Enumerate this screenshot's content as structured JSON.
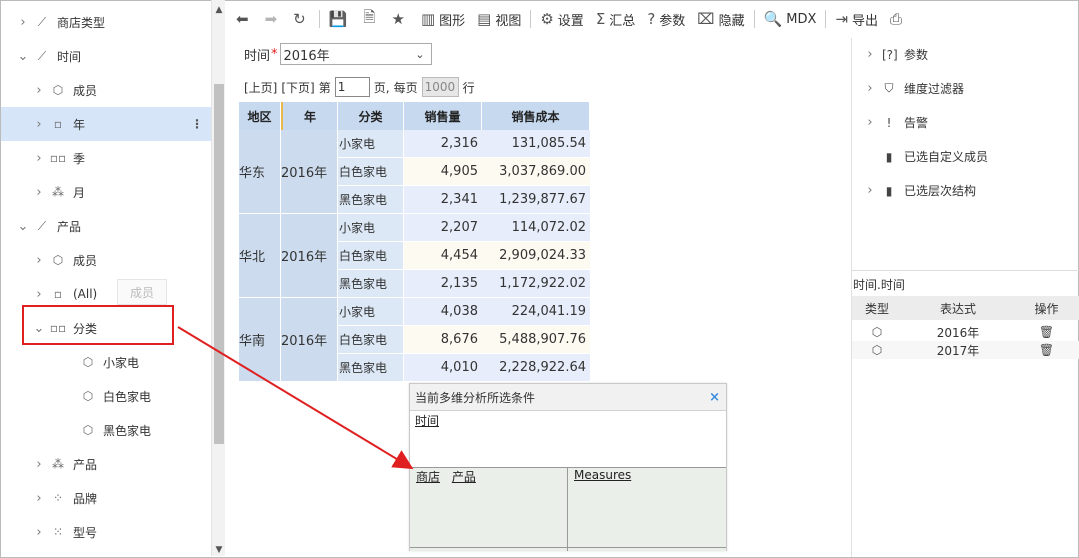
{
  "tree": {
    "items": [
      {
        "label": "商店类型",
        "icon": "hierarchy-icon",
        "glyph": "⟋",
        "chev": "›",
        "indent": 1
      },
      {
        "label": "时间",
        "icon": "hierarchy-icon",
        "glyph": "⟋",
        "chev": "⌄",
        "indent": 1
      },
      {
        "label": "成员",
        "icon": "cube-icon",
        "glyph": "⬡",
        "chev": "›",
        "indent": 2
      },
      {
        "label": "年",
        "icon": "level-icon",
        "glyph": "▫",
        "chev": "›",
        "indent": 2,
        "selected": true
      },
      {
        "label": "季",
        "icon": "level-icon",
        "glyph": "▫▫",
        "chev": "›",
        "indent": 2
      },
      {
        "label": "月",
        "icon": "level-icon",
        "glyph": "⁂",
        "chev": "›",
        "indent": 2
      },
      {
        "label": "产品",
        "icon": "hierarchy-icon",
        "glyph": "⟋",
        "chev": "⌄",
        "indent": 1
      },
      {
        "label": "成员",
        "icon": "cube-icon",
        "glyph": "⬡",
        "chev": "›",
        "indent": 2
      },
      {
        "label": "(All)",
        "icon": "level-icon",
        "glyph": "▫",
        "chev": "›",
        "indent": 2
      },
      {
        "label": "分类",
        "icon": "level-icon",
        "glyph": "▫▫",
        "chev": "⌄",
        "indent": 2
      },
      {
        "label": "小家电",
        "icon": "cube-icon",
        "glyph": "⬡",
        "chev": "",
        "indent": 3
      },
      {
        "label": "白色家电",
        "icon": "cube-icon",
        "glyph": "⬡",
        "chev": "",
        "indent": 3
      },
      {
        "label": "黑色家电",
        "icon": "cube-icon",
        "glyph": "⬡",
        "chev": "",
        "indent": 3
      },
      {
        "label": "产品",
        "icon": "level-icon",
        "glyph": "⁂",
        "chev": "›",
        "indent": 2
      },
      {
        "label": "品牌",
        "icon": "level-icon",
        "glyph": "⁘",
        "chev": "›",
        "indent": 2
      },
      {
        "label": "型号",
        "icon": "level-icon",
        "glyph": "⁙",
        "chev": "›",
        "indent": 2
      }
    ],
    "ghost_label": "成员",
    "more_menu": "⋮"
  },
  "toolbar": {
    "buttons": [
      {
        "name": "back-button",
        "icon": "arrow-left-icon",
        "glyph": "⬅",
        "label": "",
        "disabled": false
      },
      {
        "name": "forward-button",
        "icon": "arrow-right-icon",
        "glyph": "➡",
        "label": "",
        "disabled": true
      },
      {
        "name": "refresh-button",
        "icon": "refresh-icon",
        "glyph": "↻",
        "label": "",
        "disabled": false
      },
      {
        "sep": true
      },
      {
        "name": "save-button",
        "icon": "save-icon",
        "glyph": "💾",
        "label": "",
        "disabled": false
      },
      {
        "name": "saveas-button",
        "icon": "save-as-icon",
        "glyph": "🗎",
        "label": "",
        "disabled": false
      },
      {
        "name": "favorite-button",
        "icon": "star-icon",
        "glyph": "★",
        "label": "",
        "disabled": false
      },
      {
        "name": "chart-button",
        "icon": "bar-chart-icon",
        "glyph": "▥",
        "label": "图形"
      },
      {
        "name": "view-button",
        "icon": "view-icon",
        "glyph": "▤",
        "label": "视图"
      },
      {
        "sep": true
      },
      {
        "name": "settings-button",
        "icon": "gear-icon",
        "glyph": "⚙",
        "label": "设置"
      },
      {
        "name": "summary-button",
        "icon": "sigma-icon",
        "glyph": "Σ",
        "label": "汇总"
      },
      {
        "name": "param-button",
        "icon": "question-icon",
        "glyph": "?",
        "label": "参数"
      },
      {
        "name": "hide-button",
        "icon": "hide-icon",
        "glyph": "⌧",
        "label": "隐藏"
      },
      {
        "sep": true
      },
      {
        "name": "mdx-button",
        "icon": "search-icon",
        "glyph": "🔍",
        "label": "MDX"
      },
      {
        "sep": true
      },
      {
        "name": "export-button",
        "icon": "export-icon",
        "glyph": "⇥",
        "label": "导出"
      },
      {
        "name": "print-button",
        "icon": "print-icon",
        "glyph": "⎙",
        "label": ""
      }
    ]
  },
  "filter": {
    "label": "时间",
    "required_mark": "*",
    "value": "2016年"
  },
  "pager": {
    "prev": "[上页]",
    "next": "[下页]",
    "page_prefix": "第",
    "page_value": "1",
    "page_suffix": "页,",
    "size_prefix": "每页",
    "size_value": "1000",
    "size_suffix": "行"
  },
  "table": {
    "headers": [
      "地区",
      "年",
      "分类",
      "销售量",
      "销售成本"
    ],
    "groups": [
      {
        "region": "华东",
        "year": "2016年",
        "rows": [
          {
            "cat": "小家电",
            "qty": "2,316",
            "cost": "131,085.54"
          },
          {
            "cat": "白色家电",
            "qty": "4,905",
            "cost": "3,037,869.00"
          },
          {
            "cat": "黑色家电",
            "qty": "2,341",
            "cost": "1,239,877.67"
          }
        ]
      },
      {
        "region": "华北",
        "year": "2016年",
        "rows": [
          {
            "cat": "小家电",
            "qty": "2,207",
            "cost": "114,072.02"
          },
          {
            "cat": "白色家电",
            "qty": "4,454",
            "cost": "2,909,024.33"
          },
          {
            "cat": "黑色家电",
            "qty": "2,135",
            "cost": "1,172,922.02"
          }
        ]
      },
      {
        "region": "华南",
        "year": "2016年",
        "rows": [
          {
            "cat": "小家电",
            "qty": "4,038",
            "cost": "224,041.19"
          },
          {
            "cat": "白色家电",
            "qty": "8,676",
            "cost": "5,488,907.76"
          },
          {
            "cat": "黑色家电",
            "qty": "4,010",
            "cost": "2,228,922.64"
          }
        ]
      }
    ]
  },
  "right_panel": {
    "items": [
      {
        "label": "参数",
        "icon": "param-icon",
        "glyph": "[?]",
        "chev": true
      },
      {
        "label": "维度过滤器",
        "icon": "filter-icon",
        "glyph": "⛉",
        "chev": true
      },
      {
        "label": "告警",
        "icon": "alert-icon",
        "glyph": "!",
        "chev": true
      },
      {
        "label": "已选自定义成员",
        "icon": "doc-icon",
        "glyph": "▮",
        "chev": false
      },
      {
        "label": "已选层次结构",
        "icon": "doc-icon",
        "glyph": "▮",
        "chev": true
      }
    ],
    "section_title": "时间.时间",
    "columns": [
      "类型",
      "表达式",
      "操作"
    ],
    "rows": [
      {
        "type_icon": "cube-icon",
        "expr": "2016年",
        "action_icon": "trash-icon"
      },
      {
        "type_icon": "cube-icon",
        "expr": "2017年",
        "action_icon": "trash-icon"
      }
    ]
  },
  "dialog": {
    "title": "当前多维分析所选条件",
    "close": "×",
    "top_link": "时间",
    "left_links": [
      "商店",
      "产品"
    ],
    "right_link": "Measures"
  },
  "colors": {
    "arrow": "#e02020",
    "selected_row": "#d6e6f8",
    "header": "#c7d9ef"
  }
}
